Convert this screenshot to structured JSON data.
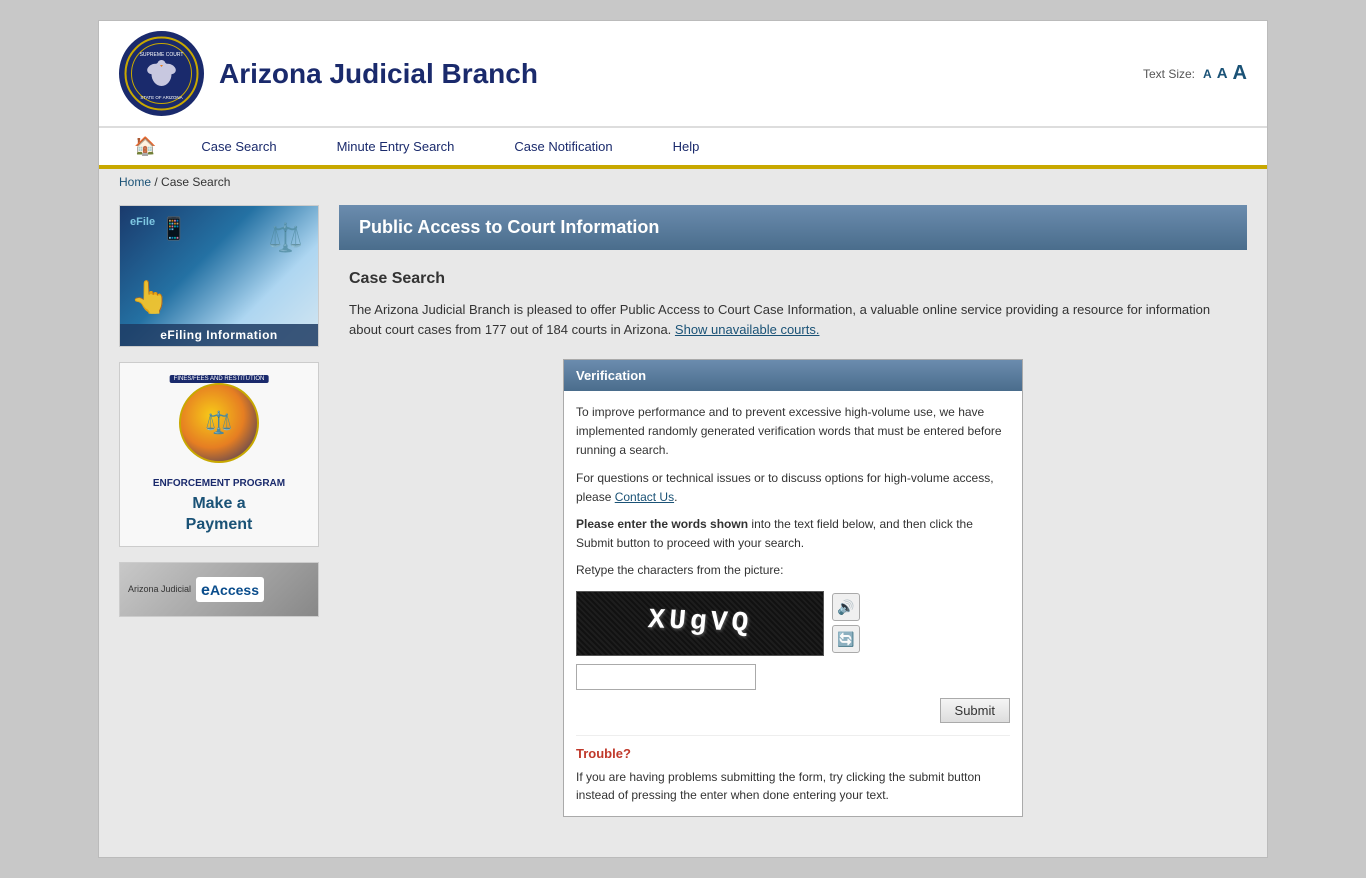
{
  "header": {
    "title": "Arizona Judicial Branch",
    "text_size_label": "Text Size:",
    "text_size_small": "A",
    "text_size_medium": "A",
    "text_size_large": "A"
  },
  "nav": {
    "home_icon": "🏠",
    "items": [
      {
        "label": "Case Search",
        "id": "case-search"
      },
      {
        "label": "Minute Entry Search",
        "id": "minute-entry-search"
      },
      {
        "label": "Case Notification",
        "id": "case-notification"
      },
      {
        "label": "Help",
        "id": "help"
      }
    ]
  },
  "breadcrumb": {
    "home": "Home",
    "separator": "/",
    "current": "Case Search"
  },
  "sidebar": {
    "efiling_label": "eFiling  Information",
    "efiling_overlay": "eFile",
    "fare_label": "FINES/FEES AND RESTITUTION",
    "fare_enforcement": "ENFORCEMENT PROGRAM",
    "make_payment_line1": "Make a",
    "make_payment_line2": "Payment",
    "eaccess_label": "eAccess",
    "eaccess_subtitle": "Arizona Judicial"
  },
  "main": {
    "page_title": "Public Access to Court Information",
    "case_search": {
      "section_title": "Case Search",
      "intro_text": "The Arizona Judicial Branch is pleased to offer Public Access to Court Case Information, a valuable online service providing a resource for information about court cases from 177 out of 184 courts in Arizona.",
      "show_unavailable_link": "Show unavailable courts.",
      "verification": {
        "title": "Verification",
        "body_text1": "To improve performance and to prevent excessive high-volume use, we have implemented randomly generated verification words that must be entered before running a search.",
        "body_text2": "For questions or technical issues or to discuss options for high-volume access, please",
        "contact_link": "Contact Us",
        "body_text3": ".",
        "instruction_bold": "Please enter the words shown",
        "instruction_rest": " into the text field below, and then click the Submit button to proceed with your search.",
        "retype_label": "Retype the characters from the picture:",
        "captcha_value": "XUgVQ",
        "captcha_input_placeholder": "",
        "refresh_icon": "🔄",
        "audio_icon": "🔊",
        "submit_label": "Submit"
      },
      "trouble": {
        "title": "Trouble?",
        "text": "If you are having problems submitting the form, try clicking the submit button instead of pressing the enter when done entering your text."
      }
    }
  }
}
